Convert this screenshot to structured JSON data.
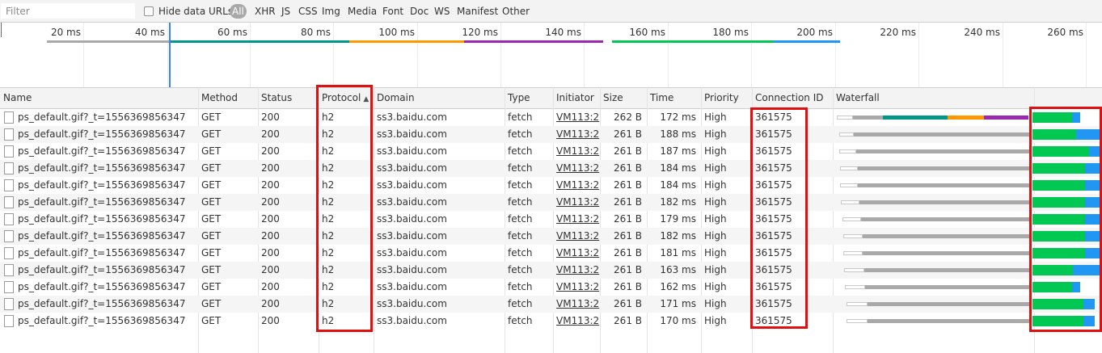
{
  "toolbar": {
    "filter_placeholder": "Filter",
    "hide_data_urls_label": "Hide data URLs",
    "hide_data_urls_checked": false,
    "type_filters": [
      "All",
      "XHR",
      "JS",
      "CSS",
      "Img",
      "Media",
      "Font",
      "Doc",
      "WS",
      "Manifest",
      "Other"
    ],
    "active_type": "All"
  },
  "overview": {
    "ticks": [
      "20 ms",
      "40 ms",
      "60 ms",
      "80 ms",
      "100 ms",
      "120 ms",
      "140 ms",
      "160 ms",
      "180 ms",
      "200 ms",
      "220 ms",
      "240 ms",
      "260 ms"
    ]
  },
  "table": {
    "columns": [
      "Name",
      "Method",
      "Status",
      "Protocol",
      "Domain",
      "Type",
      "Initiator",
      "Size",
      "Time",
      "Priority",
      "Connection ID",
      "Waterfall"
    ],
    "sorted_column": "Protocol",
    "sort_direction": "ascending",
    "rows": [
      {
        "name": "ps_default.gif?_t=1556369856347",
        "method": "GET",
        "status": "200",
        "protocol": "h2",
        "domain": "ss3.baidu.com",
        "type": "fetch",
        "initiator": "VM113:2",
        "size": "262 B",
        "time": "172 ms",
        "priority": "High",
        "connection_id": "361575"
      },
      {
        "name": "ps_default.gif?_t=1556369856347",
        "method": "GET",
        "status": "200",
        "protocol": "h2",
        "domain": "ss3.baidu.com",
        "type": "fetch",
        "initiator": "VM113:2",
        "size": "261 B",
        "time": "188 ms",
        "priority": "High",
        "connection_id": "361575"
      },
      {
        "name": "ps_default.gif?_t=1556369856347",
        "method": "GET",
        "status": "200",
        "protocol": "h2",
        "domain": "ss3.baidu.com",
        "type": "fetch",
        "initiator": "VM113:2",
        "size": "261 B",
        "time": "187 ms",
        "priority": "High",
        "connection_id": "361575"
      },
      {
        "name": "ps_default.gif?_t=1556369856347",
        "method": "GET",
        "status": "200",
        "protocol": "h2",
        "domain": "ss3.baidu.com",
        "type": "fetch",
        "initiator": "VM113:2",
        "size": "261 B",
        "time": "184 ms",
        "priority": "High",
        "connection_id": "361575"
      },
      {
        "name": "ps_default.gif?_t=1556369856347",
        "method": "GET",
        "status": "200",
        "protocol": "h2",
        "domain": "ss3.baidu.com",
        "type": "fetch",
        "initiator": "VM113:2",
        "size": "261 B",
        "time": "184 ms",
        "priority": "High",
        "connection_id": "361575"
      },
      {
        "name": "ps_default.gif?_t=1556369856347",
        "method": "GET",
        "status": "200",
        "protocol": "h2",
        "domain": "ss3.baidu.com",
        "type": "fetch",
        "initiator": "VM113:2",
        "size": "261 B",
        "time": "182 ms",
        "priority": "High",
        "connection_id": "361575"
      },
      {
        "name": "ps_default.gif?_t=1556369856347",
        "method": "GET",
        "status": "200",
        "protocol": "h2",
        "domain": "ss3.baidu.com",
        "type": "fetch",
        "initiator": "VM113:2",
        "size": "261 B",
        "time": "179 ms",
        "priority": "High",
        "connection_id": "361575"
      },
      {
        "name": "ps_default.gif?_t=1556369856347",
        "method": "GET",
        "status": "200",
        "protocol": "h2",
        "domain": "ss3.baidu.com",
        "type": "fetch",
        "initiator": "VM113:2",
        "size": "261 B",
        "time": "182 ms",
        "priority": "High",
        "connection_id": "361575"
      },
      {
        "name": "ps_default.gif?_t=1556369856347",
        "method": "GET",
        "status": "200",
        "protocol": "h2",
        "domain": "ss3.baidu.com",
        "type": "fetch",
        "initiator": "VM113:2",
        "size": "261 B",
        "time": "181 ms",
        "priority": "High",
        "connection_id": "361575"
      },
      {
        "name": "ps_default.gif?_t=1556369856347",
        "method": "GET",
        "status": "200",
        "protocol": "h2",
        "domain": "ss3.baidu.com",
        "type": "fetch",
        "initiator": "VM113:2",
        "size": "261 B",
        "time": "163 ms",
        "priority": "High",
        "connection_id": "361575"
      },
      {
        "name": "ps_default.gif?_t=1556369856347",
        "method": "GET",
        "status": "200",
        "protocol": "h2",
        "domain": "ss3.baidu.com",
        "type": "fetch",
        "initiator": "VM113:2",
        "size": "261 B",
        "time": "162 ms",
        "priority": "High",
        "connection_id": "361575"
      },
      {
        "name": "ps_default.gif?_t=1556369856347",
        "method": "GET",
        "status": "200",
        "protocol": "h2",
        "domain": "ss3.baidu.com",
        "type": "fetch",
        "initiator": "VM113:2",
        "size": "261 B",
        "time": "171 ms",
        "priority": "High",
        "connection_id": "361575"
      },
      {
        "name": "ps_default.gif?_t=1556369856347",
        "method": "GET",
        "status": "200",
        "protocol": "h2",
        "domain": "ss3.baidu.com",
        "type": "fetch",
        "initiator": "VM113:2",
        "size": "261 B",
        "time": "170 ms",
        "priority": "High",
        "connection_id": "361575"
      }
    ]
  },
  "colors": {
    "highlight_box": "#e01010",
    "timeline_marker": "#3b82f6",
    "waterfall_waiting": "#00c853",
    "waterfall_download": "#2196f3",
    "waterfall_stalled": "#a9a9a9",
    "overview_dns": "#009688",
    "overview_connect": "#ff9800",
    "overview_ssl": "#9c27b0"
  }
}
